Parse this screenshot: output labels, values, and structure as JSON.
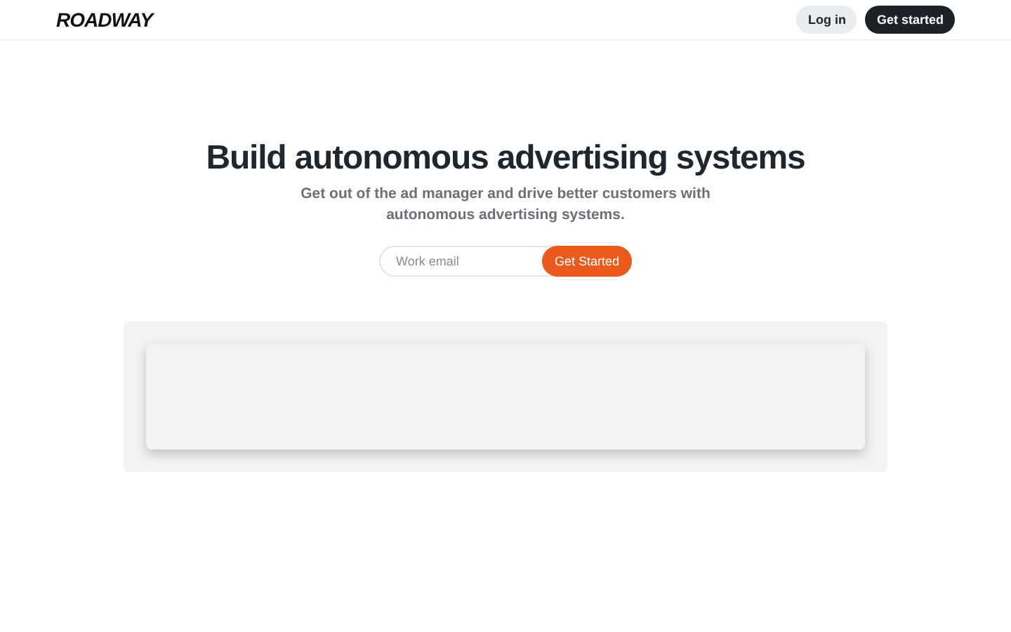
{
  "header": {
    "logo": "ROADWAY",
    "buttons": [
      {
        "label": "Log in",
        "kind": "secondary"
      },
      {
        "label": "Get started",
        "kind": "primary"
      }
    ]
  },
  "hero": {
    "title": "Build autonomous advertising systems",
    "subtitle_lines": [
      "Get out of the ad manager and drive better customers with",
      "autonomous advertising systems."
    ],
    "email": {
      "placeholder": "Work email"
    },
    "submit": "Get Started"
  }
}
